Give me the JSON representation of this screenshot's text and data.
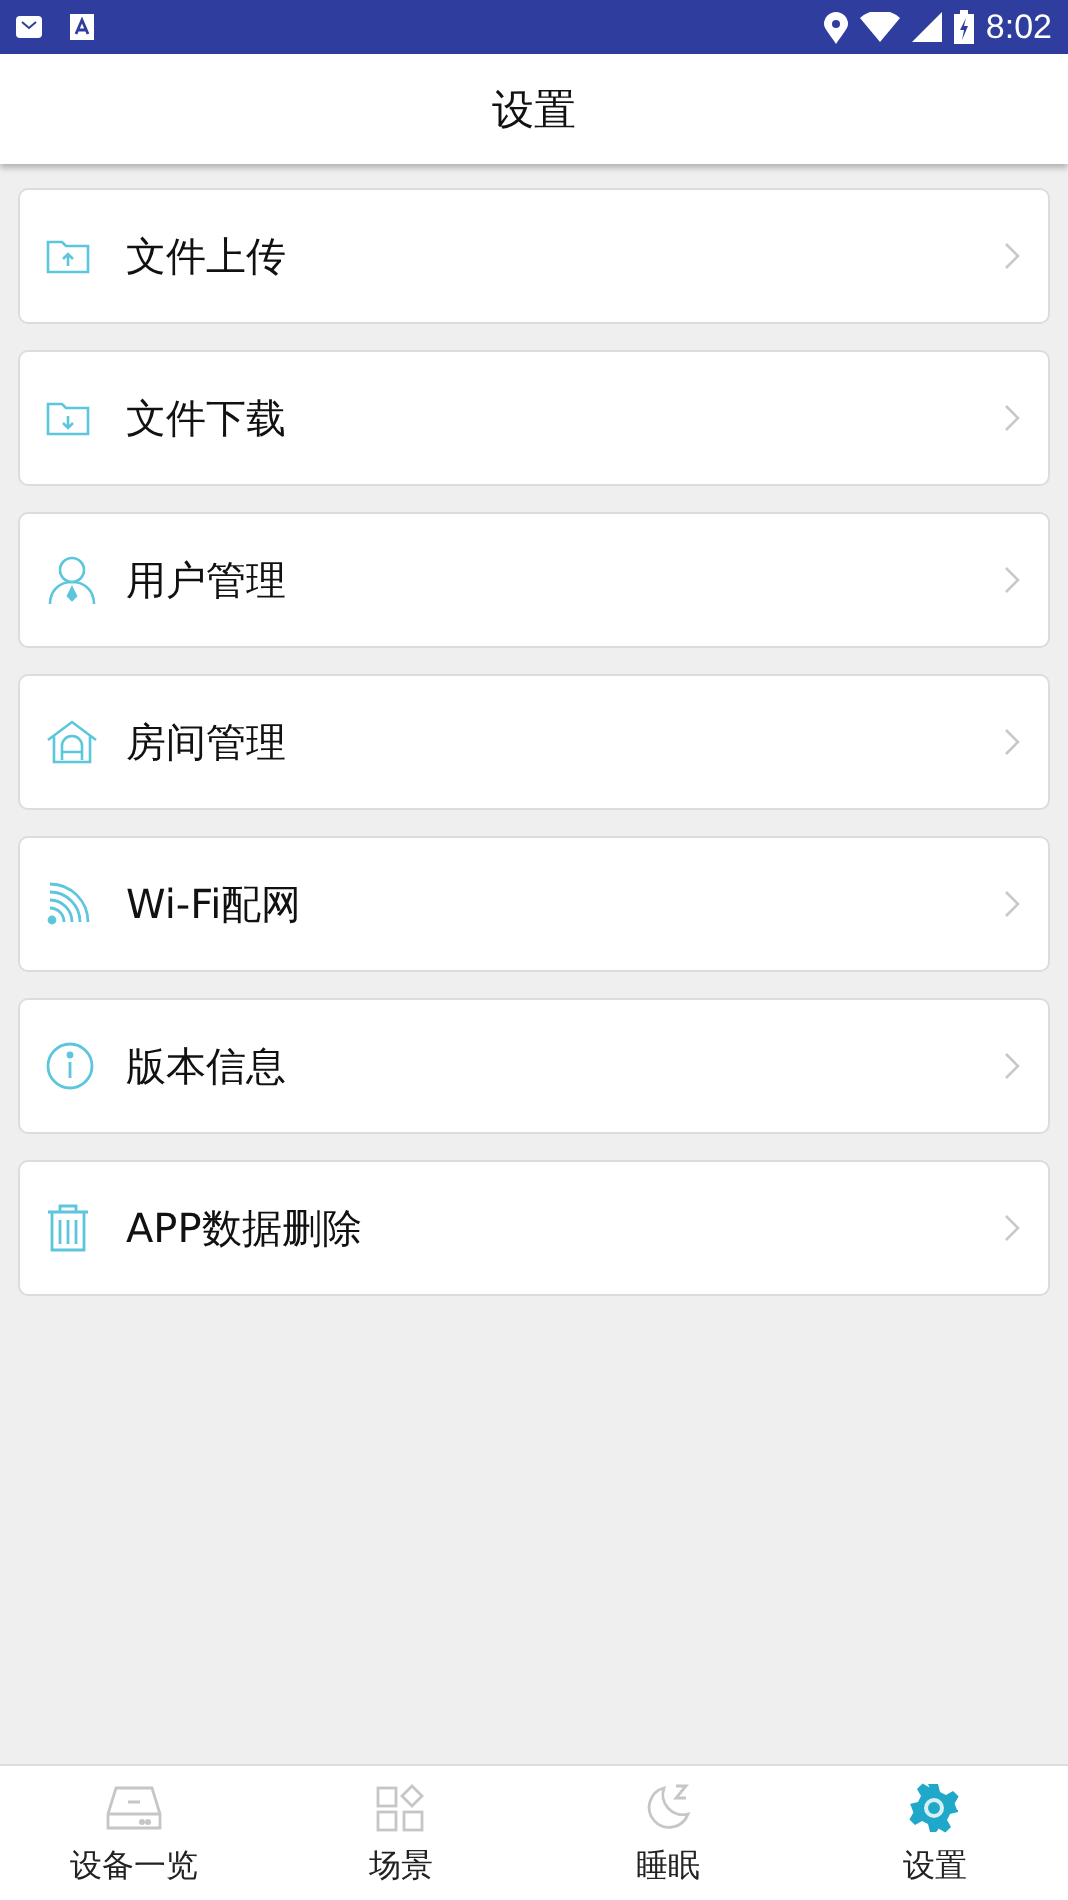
{
  "status_bar": {
    "time": "8:02"
  },
  "header": {
    "title": "设置"
  },
  "settings_items": [
    {
      "kind": "upload",
      "label": "文件上传"
    },
    {
      "kind": "download",
      "label": "文件下载"
    },
    {
      "kind": "user",
      "label": "用户管理"
    },
    {
      "kind": "house",
      "label": "房间管理"
    },
    {
      "kind": "wifi",
      "label": "Wi-Fi配网"
    },
    {
      "kind": "info",
      "label": "版本信息"
    },
    {
      "kind": "trash",
      "label": "APP数据删除"
    }
  ],
  "tabs": [
    {
      "kind": "device",
      "label": "设备一览",
      "selected": false
    },
    {
      "kind": "scene",
      "label": "场景",
      "selected": false
    },
    {
      "kind": "sleep",
      "label": "睡眠",
      "selected": false
    },
    {
      "kind": "gear",
      "label": "设置",
      "selected": true
    }
  ]
}
